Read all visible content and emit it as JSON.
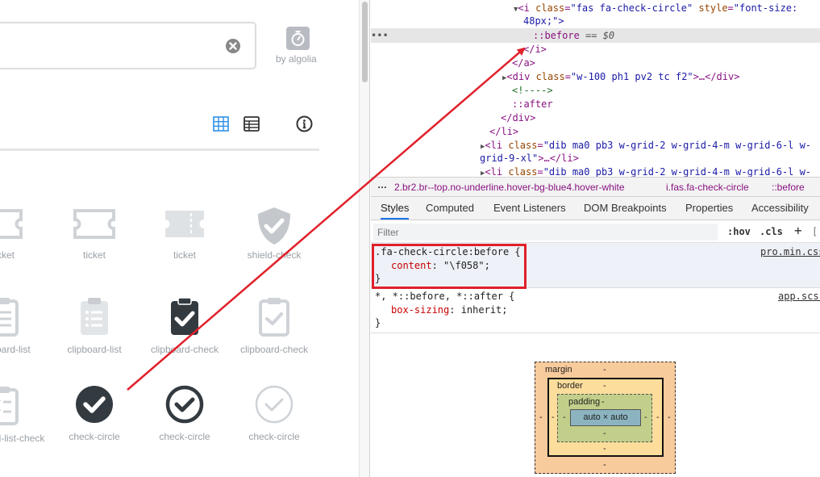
{
  "left_panel": {
    "algolia_label": "by algolia",
    "icons": [
      {
        "label": "ticket",
        "glyph": "ticket-icon"
      },
      {
        "label": "ticket",
        "glyph": "ticket-icon"
      },
      {
        "label": "ticket",
        "glyph": "ticket-icon"
      },
      {
        "label": "shield-check",
        "glyph": "shield-check-icon"
      },
      {
        "label": "clipboard-list",
        "glyph": "clipboard-list-icon"
      },
      {
        "label": "clipboard-list",
        "glyph": "clipboard-list-icon"
      },
      {
        "label": "clipboard-check",
        "glyph": "clipboard-check-icon"
      },
      {
        "label": "clipboard-check",
        "glyph": "clipboard-check-icon"
      },
      {
        "label": "clipboard-list-check",
        "glyph": "clipboard-list-check-icon"
      },
      {
        "label": "check-circle",
        "glyph": "check-circle-icon"
      },
      {
        "label": "check-circle",
        "glyph": "check-circle-icon"
      },
      {
        "label": "check-circle",
        "glyph": "check-circle-icon"
      }
    ]
  },
  "dom_tree": {
    "line1_tag": "<i",
    "line1_attr1": "class",
    "line1_val1": "\"fas fa-check-circle\"",
    "line1_attr2": "style",
    "line1_val2": "\"font-size:",
    "line2": "48px;\">",
    "before_pseudo": "::before",
    "before_suffix": "== $0",
    "close_i": "</i>",
    "close_a": "</a>",
    "div_tag": "<div",
    "div_attr": "class",
    "div_val": "\"w-100 ph1 pv2 tc f2\"",
    "div_end": ">…</div>",
    "comment": "<!---->",
    "after_pseudo": "::after",
    "close_div": "</div>",
    "close_li": "</li>",
    "li_tag": "<li",
    "li_attr": "class",
    "li_val": "\"dib ma0 pb3 w-grid-2 w-grid-4-m w-grid-6-l w-",
    "li_val_cont": "grid-9-xl\"",
    "li_end": ">…</li>",
    "li2_val": "\"dib ma0 pb3 w-grid-2 w-grid-4-m w-grid-6-l w-"
  },
  "breadcrumbs": {
    "item1": "2.br2.br--top.no-underline.hover-bg-blue4.hover-white",
    "item2": "i.fas.fa-check-circle",
    "item3": "::before"
  },
  "tabs": [
    "Styles",
    "Computed",
    "Event Listeners",
    "DOM Breakpoints",
    "Properties",
    "Accessibility"
  ],
  "filter": {
    "placeholder": "Filter",
    "hov": ":hov",
    "cls": ".cls",
    "plus": "+"
  },
  "rules": {
    "rule1_selector": ".fa-check-circle:before",
    "rule1_prop": "content",
    "rule1_value": "\"\\f058\"",
    "rule1_source": "pro.min.css",
    "rule2_selector": "*, *::before, *::after",
    "rule2_prop": "box-sizing",
    "rule2_value": "inherit",
    "rule2_source": "app.scss"
  },
  "box_model": {
    "margin_label": "margin",
    "border_label": "border",
    "padding_label": "padding",
    "content_value": "auto × auto",
    "dash": "-"
  },
  "colors": {
    "accent": "#1a73e8",
    "highlight_red": "#e0202a",
    "icon_dark": "#333a40",
    "icon_light": "#cfd3d7"
  }
}
